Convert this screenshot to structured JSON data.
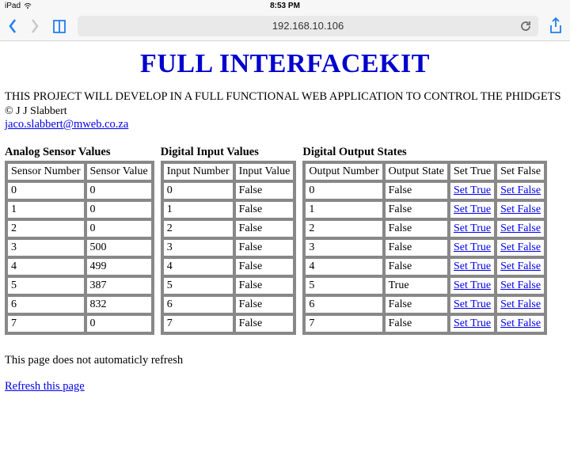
{
  "statusbar": {
    "device": "iPad",
    "time": "8:53 PM"
  },
  "browser": {
    "url": "192.168.10.106"
  },
  "page": {
    "title": "FULL INTERFACEKIT",
    "description": "THIS PROJECT WILL DEVELOP IN A FULL FUNCTIONAL WEB APPLICATION TO CONTROL THE PHIDGETS",
    "copyright": "© J J Slabbert",
    "email": "jaco.slabbert@mweb.co.za",
    "note": "This page does not automaticly refresh",
    "refresh_link": "Refresh this page"
  },
  "analog": {
    "title": "Analog Sensor Values",
    "headers": [
      "Sensor Number",
      "Sensor Value"
    ],
    "rows": [
      {
        "n": "0",
        "v": "0"
      },
      {
        "n": "1",
        "v": "0"
      },
      {
        "n": "2",
        "v": "0"
      },
      {
        "n": "3",
        "v": "500"
      },
      {
        "n": "4",
        "v": "499"
      },
      {
        "n": "5",
        "v": "387"
      },
      {
        "n": "6",
        "v": "832"
      },
      {
        "n": "7",
        "v": "0"
      }
    ]
  },
  "digin": {
    "title": "Digital Input Values",
    "headers": [
      "Input Number",
      "Input Value"
    ],
    "rows": [
      {
        "n": "0",
        "v": "False"
      },
      {
        "n": "1",
        "v": "False"
      },
      {
        "n": "2",
        "v": "False"
      },
      {
        "n": "3",
        "v": "False"
      },
      {
        "n": "4",
        "v": "False"
      },
      {
        "n": "5",
        "v": "False"
      },
      {
        "n": "6",
        "v": "False"
      },
      {
        "n": "7",
        "v": "False"
      }
    ]
  },
  "digout": {
    "title": "Digital Output States",
    "headers": [
      "Output Number",
      "Output State",
      "Set True",
      "Set False"
    ],
    "set_true_label": "Set True",
    "set_false_label": "Set False",
    "rows": [
      {
        "n": "0",
        "v": "False"
      },
      {
        "n": "1",
        "v": "False"
      },
      {
        "n": "2",
        "v": "False"
      },
      {
        "n": "3",
        "v": "False"
      },
      {
        "n": "4",
        "v": "False"
      },
      {
        "n": "5",
        "v": "True"
      },
      {
        "n": "6",
        "v": "False"
      },
      {
        "n": "7",
        "v": "False"
      }
    ]
  }
}
